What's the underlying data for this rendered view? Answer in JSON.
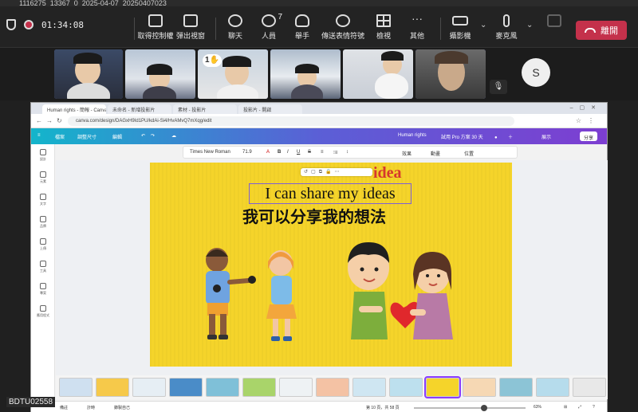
{
  "recording": {
    "label": "1116275_13367_0_2025-04-07_20250407023"
  },
  "teams": {
    "timer": "01:34:08",
    "toolbar": [
      {
        "key": "control",
        "label": "取得控制權",
        "icon": "control-icon"
      },
      {
        "key": "popout",
        "label": "彈出視窗",
        "icon": "popout-icon"
      },
      {
        "key": "chat",
        "label": "聊天",
        "icon": "chat-icon"
      },
      {
        "key": "people",
        "label": "人員",
        "icon": "people-icon",
        "count": "7"
      },
      {
        "key": "raise",
        "label": "舉手",
        "icon": "hand-icon"
      },
      {
        "key": "react",
        "label": "傳送表情符號",
        "icon": "emoji-icon"
      },
      {
        "key": "view",
        "label": "檢視",
        "icon": "grid-icon"
      },
      {
        "key": "more",
        "label": "其他",
        "icon": "more-icon"
      },
      {
        "key": "camera",
        "label": "攝影機",
        "icon": "camera-icon"
      },
      {
        "key": "mic",
        "label": "麥克風",
        "icon": "mic-icon"
      }
    ],
    "leave_label": "離開",
    "avatar_initial": "S",
    "raise_badge": "1"
  },
  "browser": {
    "tabs": [
      "Human rights - 簡報 - Canva",
      "未命名 - 新增投影片",
      "素材 - 投影片",
      "投影片 - 開啟"
    ],
    "url": "canva.com/design/DAGxH9Id1PU/kdAi-Si4/HvAMvQ7mXqg/edit"
  },
  "canva": {
    "menu": [
      "檔案",
      "調整尺寸",
      "編輯"
    ],
    "doc_title": "Human rights",
    "trial": "試用 Pro 方案 30 天",
    "share": "分享",
    "present": "展示",
    "font": "Times New Roman",
    "font_size": "71.9",
    "format_items": [
      "A",
      "B",
      "I",
      "U",
      "S",
      "≡",
      "⁝≡",
      "↕",
      "效果",
      "動畫",
      "位置"
    ],
    "rail": [
      "設計",
      "元素",
      "文字",
      "品牌",
      "上傳",
      "工具",
      "專案",
      "應用程式"
    ]
  },
  "slide": {
    "word": "idea",
    "english": "I can share my ideas",
    "chinese": "我可以分享我的想法"
  },
  "footer": {
    "notes": "備註",
    "timer": "計時",
    "recording": "錄製自己",
    "page": "第 10 頁，共 58 頁",
    "zoom": "63%",
    "zoom_level": 0.63
  },
  "corner_label": "BDTU02558",
  "colors": {
    "slide_bg": "#f5d42a",
    "idea_red": "#d6372d",
    "leave_red": "#c4314b",
    "canva_purple": "#7d3ed1",
    "canva_teal": "#13b5cb"
  }
}
